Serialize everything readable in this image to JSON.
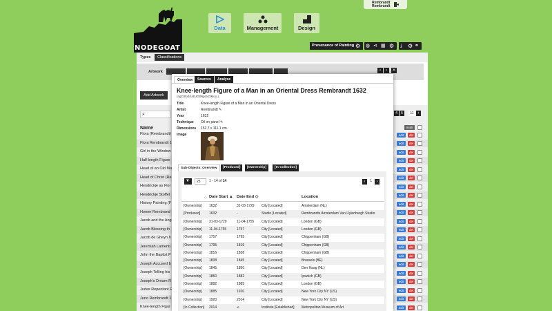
{
  "app": {
    "brand": "NODEGOAT"
  },
  "nav": [
    {
      "label": "Data",
      "icon": "data-icon"
    },
    {
      "label": "Management",
      "icon": "management-icon"
    },
    {
      "label": "Design",
      "icon": "design-icon"
    }
  ],
  "user": {
    "line1": "Rembrandt",
    "line2": "Rembrandt"
  },
  "toolbar": {
    "project": "Provenance of Paintings"
  },
  "types": {
    "label": "Types",
    "active_tab": "Classifications"
  },
  "filter": {
    "type": "Artwork"
  },
  "list": {
    "add_label": "Add Artwork",
    "header": "Name",
    "pager_page": "11",
    "pager_prev": "4",
    "pager_mid": "5",
    "more_label": "multi",
    "edit_label": "edit",
    "del_label": "del",
    "rows": [
      "Flora (Rembrandt)",
      "Flora Rembrandt 1",
      "Girl in the Window",
      "Half-length Figure",
      "Head of an Old Ma",
      "Head of Christ (Re",
      "Hendrickje as Flor",
      "Hendrickje Stoffel",
      "History Painting (F",
      "Homer Rembrand",
      "Jacob and the Ang",
      "Jacob Blessing th",
      "Jacob de Gheyn II",
      "Jeremiah Lamenti",
      "John the Baptist P",
      "Joseph Accused b",
      "Joseph Telling his",
      "Joseph's Dream R",
      "Judas Repentant F",
      "Juno Rembrandt 1",
      "Knee-length Figur"
    ]
  },
  "modal": {
    "tabs": [
      "Overview",
      "Sources",
      "Analyse"
    ],
    "title": "Knee-length Figure of a Man in an Oriental Dress Rembrandt 1632",
    "id": "(ngC8fo4K4EJGtlNpUcDMoo )",
    "fields": [
      {
        "label": "Title",
        "value": "Knee-length Figure of a Man in an Oriental Dress"
      },
      {
        "label": "Artist",
        "value": "Rembrandt ✎"
      },
      {
        "label": "Year",
        "value": "1632"
      },
      {
        "label": "Technique",
        "value": "Oil on panel ✎"
      },
      {
        "label": "Dimensions",
        "value": "152.7 x 111.1 cm."
      },
      {
        "label": "Image",
        "value": ""
      }
    ],
    "subtabs": [
      "Sub-Objects: Overview",
      "[Produced]",
      "[Ownership]",
      "[In Collection]"
    ],
    "table": {
      "per_page": "25",
      "range": "1 - 14 of ",
      "total": "14",
      "page": "1",
      "headers": [
        "Date Start ▲",
        "Date End ◇",
        "Location"
      ],
      "rows": [
        [
          "[Ownership]",
          "1632",
          "31-03-1729",
          "City [Located]",
          "Amsterdam (NL)"
        ],
        [
          "[Produced]",
          "1632",
          "-",
          "Studio [Located]",
          "Rembrandts Amsterdam Van Uylenburgh Studio"
        ],
        [
          "[Ownership]",
          "31-03-1729",
          "11-04-1755",
          "City [Located]",
          "London (GB)"
        ],
        [
          "[Ownership]",
          "11-04-1755",
          "1757",
          "City [Located]",
          "London (GB)"
        ],
        [
          "[Ownership]",
          "1757",
          "1795",
          "City [Located]",
          "Chippenham (GB)"
        ],
        [
          "[Ownership]",
          "1795",
          "1816",
          "City [Located]",
          "Chippenham (GB)"
        ],
        [
          "[Ownership]",
          "1816",
          "1838",
          "City [Located]",
          "Chippenham (GB)"
        ],
        [
          "[Ownership]",
          "1838",
          "1845",
          "City [Located]",
          "Brussels (BE)"
        ],
        [
          "[Ownership]",
          "1845",
          "1850",
          "City [Located]",
          "Den Haag (NL)"
        ],
        [
          "[Ownership]",
          "1850",
          "1882",
          "City [Located]",
          "Ipswich (GB)"
        ],
        [
          "[Ownership]",
          "1882",
          "1885",
          "City [Located]",
          "London (GB)"
        ],
        [
          "[Ownership]",
          "1885",
          "1920",
          "City [Located]",
          "New York City NY (US)"
        ],
        [
          "[Ownership]",
          "1920",
          "2014",
          "City [Located]",
          "New York City NY (US)"
        ],
        [
          "[In Collection]",
          "2014",
          "∞",
          "Institute [Established]",
          "Metropolitan Museum of Art"
        ]
      ]
    }
  },
  "colors": {
    "background": "#8fcd5c",
    "edit": "#3b7bd1",
    "delete": "#d43b3b"
  }
}
